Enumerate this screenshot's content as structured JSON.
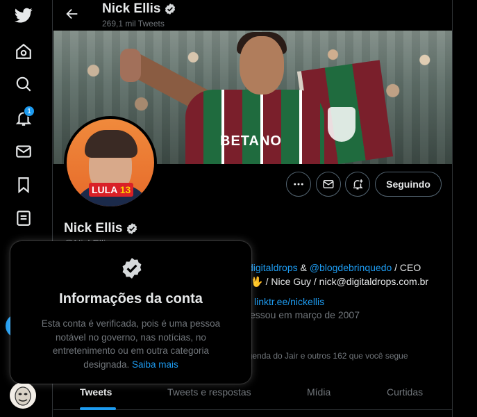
{
  "nav": {
    "notification_count": "1",
    "items": [
      "twitter-logo",
      "home-icon",
      "search-icon",
      "bell-icon",
      "mail-icon",
      "bookmark-icon",
      "lists-icon"
    ]
  },
  "header": {
    "name": "Nick Ellis",
    "tweet_count": "269,1 mil Tweets"
  },
  "banner": {
    "sponsor": "BETANO"
  },
  "avatar": {
    "badge_text": "LULA",
    "badge_number": "13"
  },
  "profile": {
    "name": "Nick Ellis",
    "handle": "@NickEllis",
    "bio_line1_link1": "digitaldrops",
    "bio_line1_sep": " & ",
    "bio_line1_link2": "@blogdebrinquedo",
    "bio_line1_rest": " / CEO",
    "bio_line2_emoji": "💚 🖖",
    "bio_line2_text": "/ Nice Guy / nick@digitaldrops.com.br",
    "website": "linktr.ee/nickellis",
    "joined": "essou em março de 2007",
    "followed_by": "agenda do Jair e outros 162 que você segue"
  },
  "actions": {
    "following_label": "Seguindo"
  },
  "tabs": [
    {
      "label": "Tweets",
      "active": true
    },
    {
      "label": "Tweets e respostas",
      "active": false
    },
    {
      "label": "Mídia",
      "active": false
    },
    {
      "label": "Curtidas",
      "active": false
    }
  ],
  "popup": {
    "title": "Informações da conta",
    "text": "Esta conta é verificada, pois é uma pessoa notável no governo, nas notícias, no entretenimento ou em outra categoria designada.",
    "link": "Saiba mais"
  },
  "colors": {
    "accent": "#1d9bf0",
    "background": "#000000",
    "muted": "#71767b"
  }
}
